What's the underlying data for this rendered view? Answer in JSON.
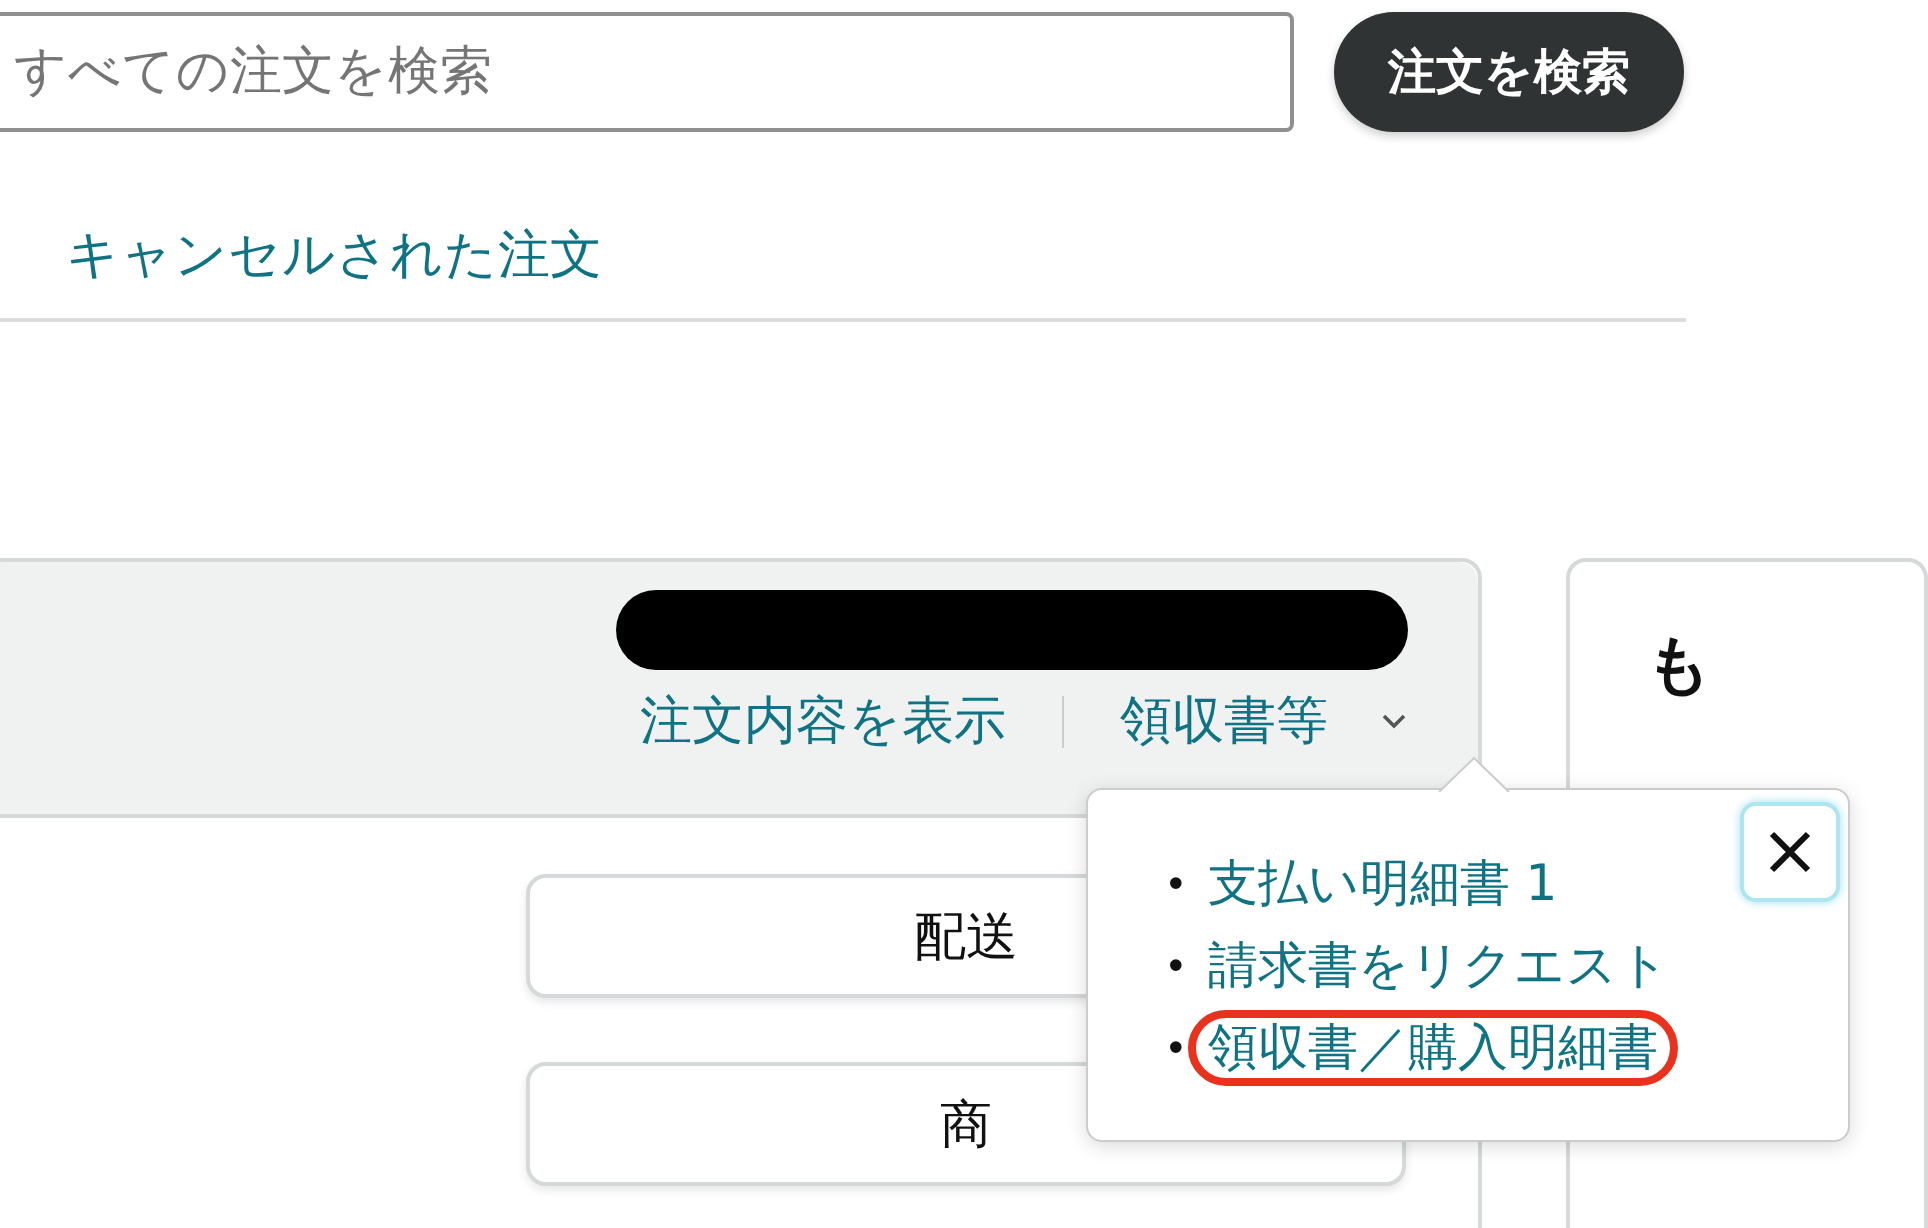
{
  "search": {
    "placeholder": "すべての注文を検索",
    "button": "注文を検索"
  },
  "tabs": [
    {
      "label": "キャンセルされた注文",
      "selected": false
    }
  ],
  "order": {
    "links": [
      "注文内容を表示",
      "領収書等"
    ],
    "buttons": [
      "配送",
      "商"
    ]
  },
  "side_card": {
    "title": "も"
  },
  "popover": {
    "items": [
      {
        "marker": "•",
        "label": "支払い明細書 1",
        "highlighted": false
      },
      {
        "marker": "•",
        "label": "請求書をリクエスト",
        "highlighted": false
      },
      {
        "marker": "•",
        "label": "領収書／購入明細書",
        "highlighted": true
      }
    ]
  }
}
